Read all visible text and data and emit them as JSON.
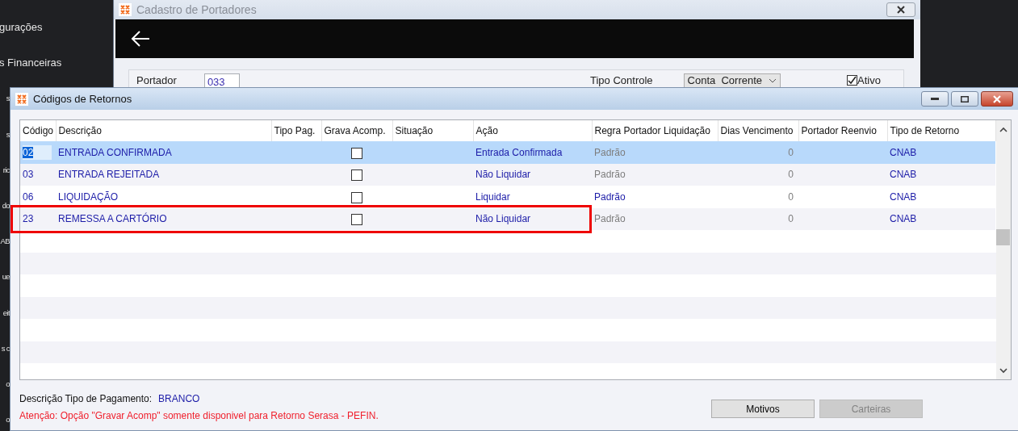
{
  "sidebar": {
    "items": [
      {
        "label": "gurações"
      },
      {
        "label": "s Financeiras"
      },
      {
        "label": "s"
      },
      {
        "label": "s"
      },
      {
        "label": "ric"
      },
      {
        "label": "do"
      },
      {
        "label": "AB"
      },
      {
        "label": "ue"
      },
      {
        "label": "eit"
      },
      {
        "label": "s c"
      },
      {
        "label": "o"
      },
      {
        "label": "o"
      }
    ]
  },
  "back_window": {
    "title": "Cadastro de Portadores",
    "fields": [
      {
        "kind": "text",
        "label": "Portador",
        "value": "033"
      },
      {
        "kind": "select",
        "label": "Tipo Controle",
        "value": "Conta  Corrente"
      },
      {
        "kind": "checkbox",
        "label": "Ativo",
        "checked": true
      }
    ]
  },
  "dialog": {
    "title": "Códigos de Retornos",
    "table": {
      "columns": [
        "Código",
        "Descrição",
        "Tipo Pag.",
        "Grava Acomp.",
        "Situação",
        "Ação",
        "Regra Portador Liquidação",
        "Dias Vencimento",
        "Portador Reenvio",
        "Tipo de Retorno"
      ],
      "rows": [
        {
          "codigo": "02",
          "descricao": "ENTRADA CONFIRMADA",
          "grava_acomp": false,
          "acao": "Entrada Confirmada",
          "regra": "Padrão",
          "regra_enabled": false,
          "dias": "0",
          "tipo_retorno": "CNAB",
          "selected": true,
          "highlighted": false
        },
        {
          "codigo": "03",
          "descricao": "ENTRADA REJEITADA",
          "grava_acomp": false,
          "acao": "Não Liquidar",
          "regra": "Padrão",
          "regra_enabled": false,
          "dias": "0",
          "tipo_retorno": "CNAB",
          "selected": false,
          "highlighted": false
        },
        {
          "codigo": "06",
          "descricao": "LIQUIDAÇÃO",
          "grava_acomp": false,
          "acao": "Liquidar",
          "regra": "Padrão",
          "regra_enabled": true,
          "dias": "0",
          "tipo_retorno": "CNAB",
          "selected": false,
          "highlighted": false
        },
        {
          "codigo": "23",
          "descricao": "REMESSA A CARTÓRIO",
          "grava_acomp": false,
          "acao": "Não Liquidar",
          "regra": "Padrão",
          "regra_enabled": false,
          "dias": "0",
          "tipo_retorno": "CNAB",
          "selected": false,
          "highlighted": true
        }
      ]
    },
    "footer": {
      "label": "Descrição Tipo de Pagamento:",
      "value": "BRANCO",
      "warning": "Atenção: Opção \"Gravar Acomp\" somente disponivel para Retorno Serasa - PEFIN."
    },
    "buttons": [
      {
        "label": "Motivos",
        "disabled": false
      },
      {
        "label": "Carteiras",
        "disabled": true
      }
    ]
  }
}
